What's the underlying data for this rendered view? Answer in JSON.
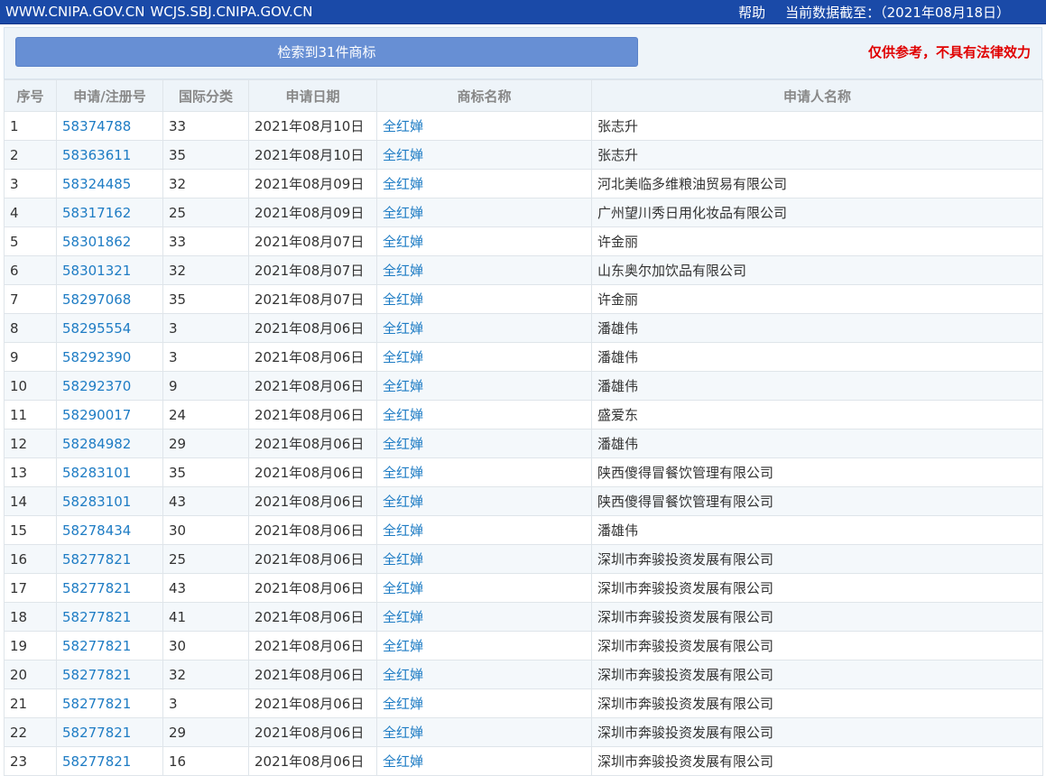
{
  "header": {
    "sites": [
      "WWW.CNIPA.GOV.CN",
      "WCJS.SBJ.CNIPA.GOV.CN"
    ],
    "help": "帮助",
    "data_date": "当前数据截至：（2021年08月18日）"
  },
  "result": {
    "button_label": "检索到31件商标",
    "disclaimer": "仅供参考，不具有法律效力"
  },
  "table": {
    "columns": [
      "序号",
      "申请/注册号",
      "国际分类",
      "申请日期",
      "商标名称",
      "申请人名称"
    ],
    "rows": [
      [
        "1",
        "58374788",
        "33",
        "2021年08月10日",
        "全红婵",
        "张志升"
      ],
      [
        "2",
        "58363611",
        "35",
        "2021年08月10日",
        "全红婵",
        "张志升"
      ],
      [
        "3",
        "58324485",
        "32",
        "2021年08月09日",
        "全红婵",
        "河北美临多维粮油贸易有限公司"
      ],
      [
        "4",
        "58317162",
        "25",
        "2021年08月09日",
        "全红婵",
        "广州望川秀日用化妆品有限公司"
      ],
      [
        "5",
        "58301862",
        "33",
        "2021年08月07日",
        "全红婵",
        "许金丽"
      ],
      [
        "6",
        "58301321",
        "32",
        "2021年08月07日",
        "全红婵",
        "山东奥尔加饮品有限公司"
      ],
      [
        "7",
        "58297068",
        "35",
        "2021年08月07日",
        "全红婵",
        "许金丽"
      ],
      [
        "8",
        "58295554",
        "3",
        "2021年08月06日",
        "全红婵",
        "潘雄伟"
      ],
      [
        "9",
        "58292390",
        "3",
        "2021年08月06日",
        "全红婵",
        "潘雄伟"
      ],
      [
        "10",
        "58292370",
        "9",
        "2021年08月06日",
        "全红婵",
        "潘雄伟"
      ],
      [
        "11",
        "58290017",
        "24",
        "2021年08月06日",
        "全红婵",
        "盛爱东"
      ],
      [
        "12",
        "58284982",
        "29",
        "2021年08月06日",
        "全红婵",
        "潘雄伟"
      ],
      [
        "13",
        "58283101",
        "35",
        "2021年08月06日",
        "全红婵",
        "陕西傻得冒餐饮管理有限公司"
      ],
      [
        "14",
        "58283101",
        "43",
        "2021年08月06日",
        "全红婵",
        "陕西傻得冒餐饮管理有限公司"
      ],
      [
        "15",
        "58278434",
        "30",
        "2021年08月06日",
        "全红婵",
        "潘雄伟"
      ],
      [
        "16",
        "58277821",
        "25",
        "2021年08月06日",
        "全红婵",
        "深圳市奔骏投资发展有限公司"
      ],
      [
        "17",
        "58277821",
        "43",
        "2021年08月06日",
        "全红婵",
        "深圳市奔骏投资发展有限公司"
      ],
      [
        "18",
        "58277821",
        "41",
        "2021年08月06日",
        "全红婵",
        "深圳市奔骏投资发展有限公司"
      ],
      [
        "19",
        "58277821",
        "30",
        "2021年08月06日",
        "全红婵",
        "深圳市奔骏投资发展有限公司"
      ],
      [
        "20",
        "58277821",
        "32",
        "2021年08月06日",
        "全红婵",
        "深圳市奔骏投资发展有限公司"
      ],
      [
        "21",
        "58277821",
        "3",
        "2021年08月06日",
        "全红婵",
        "深圳市奔骏投资发展有限公司"
      ],
      [
        "22",
        "58277821",
        "29",
        "2021年08月06日",
        "全红婵",
        "深圳市奔骏投资发展有限公司"
      ],
      [
        "23",
        "58277821",
        "16",
        "2021年08月06日",
        "全红婵",
        "深圳市奔骏投资发展有限公司"
      ]
    ]
  },
  "colors": {
    "header_bg": "#1a4aa8",
    "button_bg": "#678fd4",
    "link": "#1e7cc4",
    "disclaimer": "#e00000"
  }
}
